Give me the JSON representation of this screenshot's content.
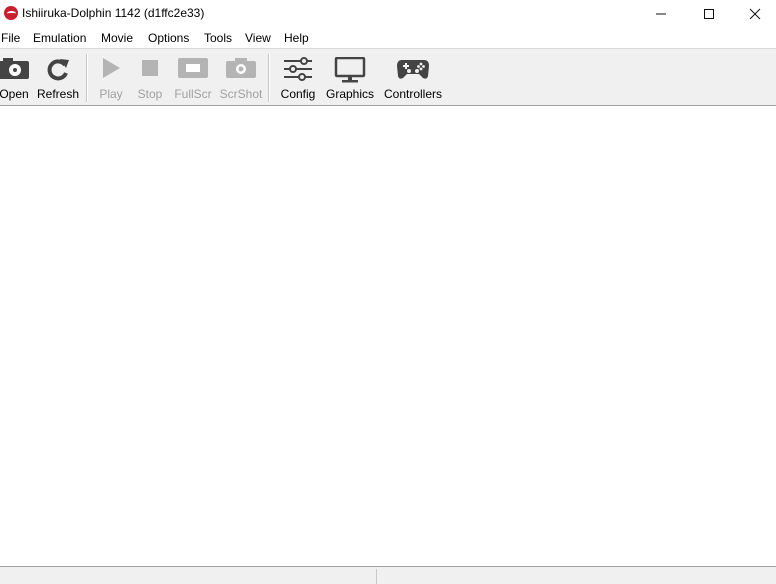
{
  "window": {
    "title": "Ishiiruka-Dolphin  1142 (d1ffc2e33)",
    "accent": "#c8202f"
  },
  "menu": {
    "items": [
      "File",
      "Emulation",
      "Movie",
      "Options",
      "Tools",
      "View",
      "Help"
    ]
  },
  "toolbar": {
    "buttons": [
      {
        "label": "Open",
        "icon": "open-disc-icon",
        "enabled": true
      },
      {
        "label": "Refresh",
        "icon": "refresh-icon",
        "enabled": true
      },
      {
        "label": "Play",
        "icon": "play-icon",
        "enabled": false
      },
      {
        "label": "Stop",
        "icon": "stop-icon",
        "enabled": false
      },
      {
        "label": "FullScr",
        "icon": "fullscreen-icon",
        "enabled": false
      },
      {
        "label": "ScrShot",
        "icon": "screenshot-camera-icon",
        "enabled": false
      },
      {
        "label": "Config",
        "icon": "sliders-icon",
        "enabled": true
      },
      {
        "label": "Graphics",
        "icon": "monitor-icon",
        "enabled": true
      },
      {
        "label": "Controllers",
        "icon": "gamepad-icon",
        "enabled": true
      }
    ]
  }
}
